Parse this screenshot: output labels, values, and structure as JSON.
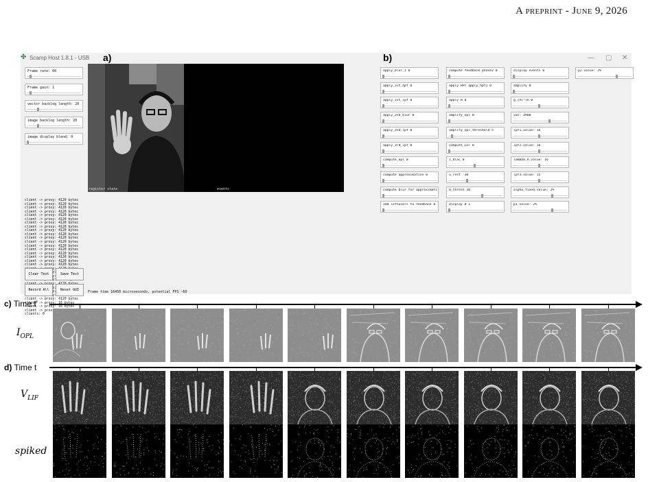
{
  "header": {
    "prefix": "A",
    "rest": "preprint - June 9, 2026"
  },
  "app": {
    "window_title": "Scamp Host 1.8.1 - USB",
    "panel_a": "a)",
    "panel_b": "b)",
    "window_controls": [
      "—",
      "▢",
      "✕"
    ],
    "left_fields": [
      {
        "text": "Frame rate: 60",
        "level": 0.05
      },
      {
        "text": "Frame gain: 1",
        "level": 0.05
      },
      {
        "text": "vector backlog length: 20",
        "level": 0.2
      },
      {
        "text": "image backlog length: 20",
        "level": 0.2
      },
      {
        "text": "image display blend: 0",
        "level": 0.0
      }
    ],
    "log_lines": [
      "client -> proxy: 4120 bytes",
      "client -> proxy: 4120 bytes",
      "client -> proxy: 4120 bytes",
      "client -> proxy: 4120 bytes",
      "client -> proxy: 4120 bytes",
      "client -> proxy: 4120 bytes",
      "client -> proxy: 4120 bytes",
      "client -> proxy: 4120 bytes",
      "client -> proxy: 4120 bytes",
      "client -> proxy: 4120 bytes",
      "client -> proxy: 4120 bytes",
      "client -> proxy: 4120 bytes",
      "client -> proxy: 4120 bytes",
      "client -> proxy: 4120 bytes",
      "client -> proxy: 4120 bytes",
      "client -> proxy: 4120 bytes",
      "client -> proxy: 4120 bytes",
      "client -> proxy: 4120 bytes",
      "client -> proxy: 4120 bytes",
      "client -> proxy: 4120 bytes",
      "client -> proxy: 4120 bytes",
      "client -> proxy: 4120 bytes",
      "client -> proxy: 4120 bytes",
      "client -> proxy: 4120 bytes",
      "client -> proxy: 4120 bytes",
      "client -> proxy: 4120 bytes",
      "client -> proxy: 4120 bytes",
      "client -> proxy: 16 bytes",
      "client -> proxy: 16 bytes",
      "client -> proxy: 16 bytes",
      "clients: 0"
    ],
    "buttons": {
      "clear": "Clear Text",
      "save": "Save Text",
      "record": "Record All",
      "reset": "Reset GUI"
    },
    "camera_labels": {
      "left": "register state",
      "right": "events"
    },
    "frame_time": "Frame time 16450 microseconds, potential FPS ~60",
    "param_columns": [
      [
        {
          "text": "apply_blur_1 0",
          "level": 0.0
        },
        {
          "text": "apply_1st_hpf 0",
          "level": 0.0
        },
        {
          "text": "apply_1st_lpf 0",
          "level": 0.0
        },
        {
          "text": "apply_2nd_blur 0",
          "level": 0.0
        },
        {
          "text": "apply_2nd_lpf 0",
          "level": 0.0
        },
        {
          "text": "apply_3rd_lpf 0",
          "level": 0.0
        },
        {
          "text": "compute_opl 0",
          "level": 0.0
        },
        {
          "text": "compute approximation 0",
          "level": 0.0
        },
        {
          "text": "compute blur for approximation 0",
          "level": 0.0
        },
        {
          "text": "add leftovers to feedback 0",
          "level": 0.0
        }
      ],
      [
        {
          "text": "compute feedback phase2 0",
          "level": 0.0
        },
        {
          "text": "apply HPF apply_hpf2 0",
          "level": 0.0
        },
        {
          "text": "apply H 0",
          "level": 0.0
        },
        {
          "text": "amplify_opl 0",
          "level": 0.0
        },
        {
          "text": "amplify_opl_threshold 5",
          "level": 0.05
        },
        {
          "text": "compute_LIF 0",
          "level": 0.0
        },
        {
          "text": "I_blac 0",
          "level": 0.5
        },
        {
          "text": "u_rest -30",
          "level": 0.35
        },
        {
          "text": "U_thresh 30",
          "level": 0.65
        },
        {
          "text": "display 0 1",
          "level": 0.0
        }
      ],
      [
        {
          "text": "display events 0",
          "level": 0.0
        },
        {
          "text": "amplify 0",
          "level": 0.0
        },
        {
          "text": "g_{A}^{A 0",
          "level": 0.5
        },
        {
          "text": "vac: 2900",
          "level": 0.7
        },
        {
          "text": "lpf1.value: 16",
          "level": 0.5
        },
        {
          "text": "lpf2.value: 16",
          "level": 0.5
        },
        {
          "text": "lambda_A.value: 16",
          "level": 0.5
        },
        {
          "text": "lpf3.value: 15",
          "level": 0.5
        },
        {
          "text": "alpha_fixed.value: 2%",
          "level": 0.75
        },
        {
          "text": "p1.value: 2%",
          "level": 0.75
        }
      ],
      [
        {
          "text": "p2.value: 2%",
          "level": 0.75
        }
      ]
    ]
  },
  "rows": {
    "c_label": "c)",
    "c_text": "Time t'",
    "d_label": "d)",
    "d_text": "Time t",
    "iopl_main": "I",
    "iopl_sub": "OPL",
    "vlif_main": "V",
    "vlif_sub": "LIF",
    "spiked": "spiked"
  },
  "colors": {
    "window_bg": "#f0f0f0",
    "field_border": "#b9b9b9",
    "icon_green": "#2e8b57"
  }
}
